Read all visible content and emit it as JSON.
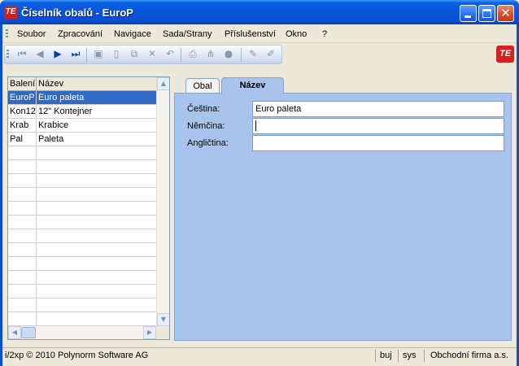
{
  "window": {
    "title": "Číselník obalů - EuroP",
    "logo_text": "TE"
  },
  "menu": [
    "Soubor",
    "Zpracování",
    "Navigace",
    "Sada/Strany",
    "Příslušenství",
    "Okno",
    "?"
  ],
  "toolbar": {
    "buttons": [
      {
        "icon": "first-record-icon",
        "glyph": "⏮"
      },
      {
        "icon": "previous-record-icon",
        "glyph": "◀"
      },
      {
        "icon": "next-record-icon",
        "glyph": "▶"
      },
      {
        "icon": "last-record-icon",
        "glyph": "⏭"
      },
      {
        "icon": "save-icon",
        "glyph": "▣"
      },
      {
        "icon": "new-icon",
        "glyph": "▯"
      },
      {
        "icon": "copy-icon",
        "glyph": "⧉"
      },
      {
        "icon": "delete-icon",
        "glyph": "✕"
      },
      {
        "icon": "undo-icon",
        "glyph": "↶"
      },
      {
        "icon": "print-icon",
        "glyph": "⎙"
      },
      {
        "icon": "tree-icon",
        "glyph": "⋔"
      },
      {
        "icon": "record-icon",
        "glyph": "●"
      },
      {
        "icon": "edit-icon",
        "glyph": "✎"
      },
      {
        "icon": "eraser-icon",
        "glyph": "✐"
      }
    ],
    "corp_logo": "TE"
  },
  "grid": {
    "columns": [
      "Balení",
      "Název"
    ],
    "rows": [
      [
        "EuroP",
        "Euro paleta"
      ],
      [
        "Kon12",
        "12\" Kontejner"
      ],
      [
        "Krab",
        "Krabice"
      ],
      [
        "Pal",
        "Paleta"
      ]
    ],
    "selected_index": 0,
    "empty_rows": 13
  },
  "tabs": [
    "Obal",
    "Název"
  ],
  "active_tab": "Název",
  "form": {
    "fields": [
      {
        "label": "Čeština:",
        "value": "Euro paleta"
      },
      {
        "label": "Němčina:",
        "value": ""
      },
      {
        "label": "Angličtina:",
        "value": ""
      }
    ]
  },
  "status": {
    "copyright": "i/2xp © 2010 Polynorm Software AG",
    "user": "buj",
    "system": "sys",
    "company": "Obchodní firma a.s."
  }
}
